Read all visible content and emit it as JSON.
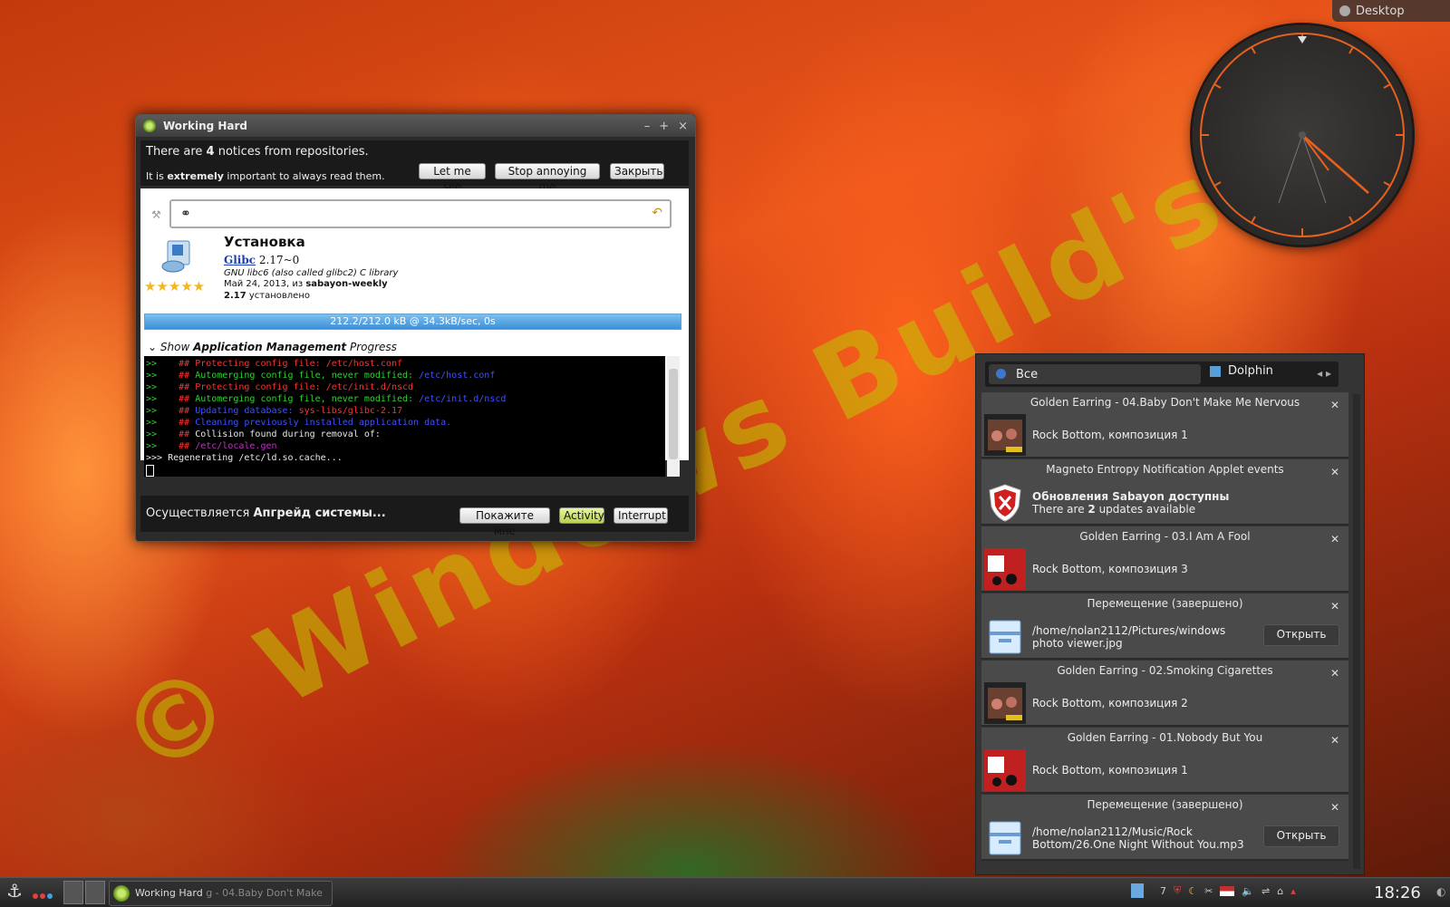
{
  "desktop": {
    "label": "Desktop"
  },
  "watermark": {
    "text": "© Windows Build's"
  },
  "window": {
    "title": "Working Hard",
    "controls": [
      "–",
      "+",
      "×"
    ],
    "notice_line1_pre": "There are ",
    "notice_count": "4",
    "notice_line1_post": " notices from repositories.",
    "notice_line2_pre": "It is ",
    "notice_line2_bold": "extremely",
    "notice_line2_post": " important to always read them.",
    "btn_let_me_see": "Let me see",
    "btn_stop_annoying": "Stop annoying me",
    "btn_close": "Закрыть",
    "pkg_title": "Установка",
    "pkg_name": "Glibc",
    "pkg_version": " 2.17~0",
    "pkg_desc": "GNU libc6 (also called glibc2) C library",
    "pkg_date_pre": "Май 24, 2013, из ",
    "pkg_repo": "sabayon-weekly",
    "pkg_installed_ver": "2.17",
    "pkg_installed_label": " установлено",
    "stars": "★★★★★",
    "progress_text": "212.2/212.0 kB @ 34.3kB/sec, 0s",
    "progress_value": 1.0,
    "show_pre": "Show ",
    "show_bold": "Application Management",
    "show_post": " Progress",
    "status_pre": "Осуществляется ",
    "status_bold": "Апгрейд системы...",
    "btn_show_me": "Покажите мне",
    "btn_activity": "Activity",
    "btn_interrupt": "Interrupt"
  },
  "terminal_lines": [
    {
      "p": ">>",
      "a": "##",
      "b": " Protecting config file: /etc/host.conf",
      "c": "",
      "color": "red"
    },
    {
      "p": ">>",
      "a": "##",
      "b": " Automerging config file, never modified: ",
      "c": "/etc/host.conf",
      "color": "green"
    },
    {
      "p": ">>",
      "a": "##",
      "b": " Protecting config file: /etc/init.d/nscd",
      "c": "",
      "color": "red"
    },
    {
      "p": ">>",
      "a": "##",
      "b": " Automerging config file, never modified: ",
      "c": "/etc/init.d/nscd",
      "color": "green"
    },
    {
      "p": ">>",
      "a": "##",
      "b": " Updating database: ",
      "c": "sys-libs/glibc-2.17",
      "color": "blue"
    },
    {
      "p": ">>",
      "a": "##",
      "b": " Cleaning previously installed application data.",
      "c": "",
      "color": "blue"
    },
    {
      "p": ">>",
      "a": "##",
      "b": " Collision found during removal of:",
      "c": "",
      "color": "white"
    },
    {
      "p": ">>",
      "a": "##",
      "b": " /etc/locale.gen",
      "c": "",
      "color": "magenta"
    },
    {
      "p": ">>>",
      "a": "",
      "b": " Regenerating /etc/ld.so.cache...",
      "c": "",
      "color": "white"
    }
  ],
  "notifications_panel": {
    "filter_label": "Все",
    "app_label": "Dolphin",
    "items": [
      {
        "title": "Golden Earring - 04.Baby Don't Make Me Nervous",
        "body": "Rock Bottom, композиция 1",
        "kind": "album-a"
      },
      {
        "title": "Magneto Entropy Notification Applet events",
        "body_bold": "Обновления Sabayon доступны",
        "body_pre": "There are ",
        "body_count": "2",
        "body_post": " updates available",
        "kind": "shield"
      },
      {
        "title": "Golden Earring - 03.I Am A Fool",
        "body": "Rock Bottom, композиция 3",
        "kind": "album-b"
      },
      {
        "title": "Перемещение (завершено)",
        "body_l1": "/home/nolan2112/Pictures/windows",
        "body_l2": "photo viewer.jpg",
        "button": "Открыть",
        "kind": "folder"
      },
      {
        "title": "Golden Earring - 02.Smoking Cigarettes",
        "body": "Rock Bottom, композиция 2",
        "kind": "album-a"
      },
      {
        "title": "Golden Earring - 01.Nobody But You",
        "body": "Rock Bottom, композиция 1",
        "kind": "album-b"
      },
      {
        "title": "Перемещение (завершено)",
        "body_l1": "/home/nolan2112/Music/Rock",
        "body_l2": "Bottom/26.One Night Without You.mp3",
        "button": "Открыть",
        "kind": "folder"
      }
    ]
  },
  "taskbar": {
    "task_label": "Working Hard",
    "task_label_ghost": "g - 04.Baby Don't Make",
    "tray_count": "7",
    "time": "18:26"
  }
}
